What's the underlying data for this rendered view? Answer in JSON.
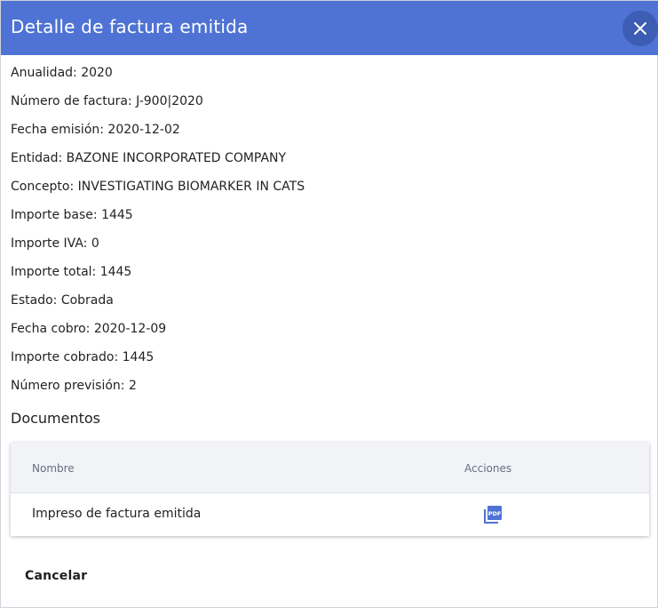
{
  "dialog": {
    "title": "Detalle de factura emitida",
    "fields": [
      "Anualidad: 2020",
      "Número de factura: J-900|2020",
      "Fecha emisión: 2020-12-02",
      "Entidad: BAZONE INCORPORATED COMPANY",
      "Concepto: INVESTIGATING BIOMARKER IN CATS",
      "Importe base: 1445",
      "Importe IVA: 0",
      "Importe total: 1445",
      "Estado: Cobrada",
      "Fecha cobro: 2020-12-09",
      "Importe cobrado: 1445",
      "Número previsión: 2"
    ],
    "documents": {
      "title": "Documentos",
      "columns": [
        "Nombre",
        "Acciones"
      ],
      "rows": [
        {
          "name": "Impreso de factura emitida",
          "action_icon": "pdf-icon"
        }
      ]
    },
    "cancel_label": "Cancelar"
  },
  "colors": {
    "header": "#4f73d4",
    "close_button": "#3d5cb3",
    "pdf_icon": "#4f73d4"
  }
}
